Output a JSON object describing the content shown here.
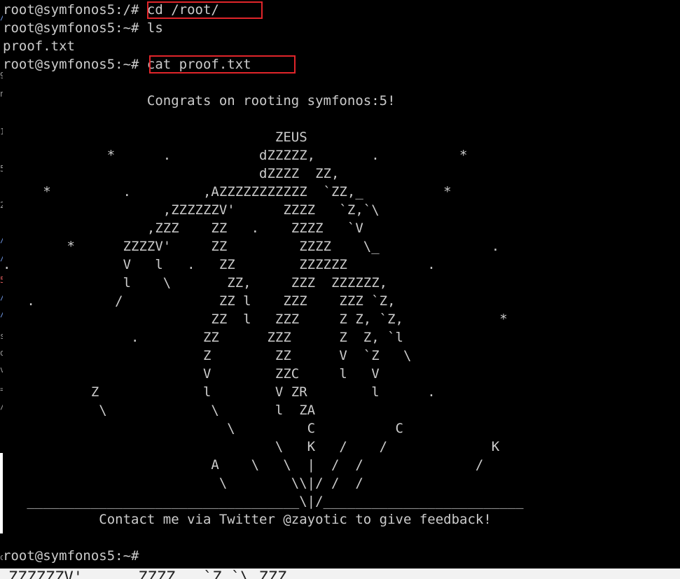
{
  "terminal": {
    "lines": [
      "root@symfonos5:/# cd /root/",
      "root@symfonos5:~# ls",
      "proof.txt",
      "root@symfonos5:~# cat proof.txt",
      "",
      "                  Congrats on rooting symfonos:5!",
      "",
      "                                  ZEUS",
      "             *      .           dZZZZZ,       .          *",
      "                                dZZZZ  ZZ,",
      "     *         .         ,AZZZZZZZZZZZ  `ZZ,_          *",
      "                    ,ZZZZZZV'      ZZZZ   `Z,`\\",
      "                  ,ZZZ    ZZ   .    ZZZZ   `V",
      "        *      ZZZZV'     ZZ         ZZZZ    \\_              .",
      ".              V   l   .   ZZ        ZZZZZZ          .",
      "               l    \\       ZZ,     ZZZ  ZZZZZZ,",
      "   .          /            ZZ l    ZZZ    ZZZ `Z,",
      "                          ZZ  l   ZZZ     Z Z, `Z,            *",
      "                .        ZZ      ZZZ      Z  Z, `l",
      "                         Z        ZZ      V  `Z   \\",
      "                         V        ZZC     l   V",
      "           Z             l        V ZR        l      .",
      "            \\             \\       l  ZA",
      "                            \\         C          C",
      "                                  \\   K   /    /             K",
      "                          A    \\   \\  |  /  /              /",
      "                           \\        \\\\|/ /  /",
      "   __________________________________\\|/_________________________",
      "            Contact me via Twitter @zayotic to give feedback!",
      "",
      "root@symfonos5:~# "
    ],
    "bottom_fragment": "ZZZZZZV'      ZZZZ   `Z,`\\ ZZZ"
  },
  "highlights": [
    {
      "name": "highlight-cd-root",
      "label": "cd /root/"
    },
    {
      "name": "highlight-cat-proof",
      "label": "cat proof.txt"
    }
  ],
  "colors": {
    "background": "#000000",
    "text": "#cccccc",
    "highlight_border": "#e0252a"
  }
}
